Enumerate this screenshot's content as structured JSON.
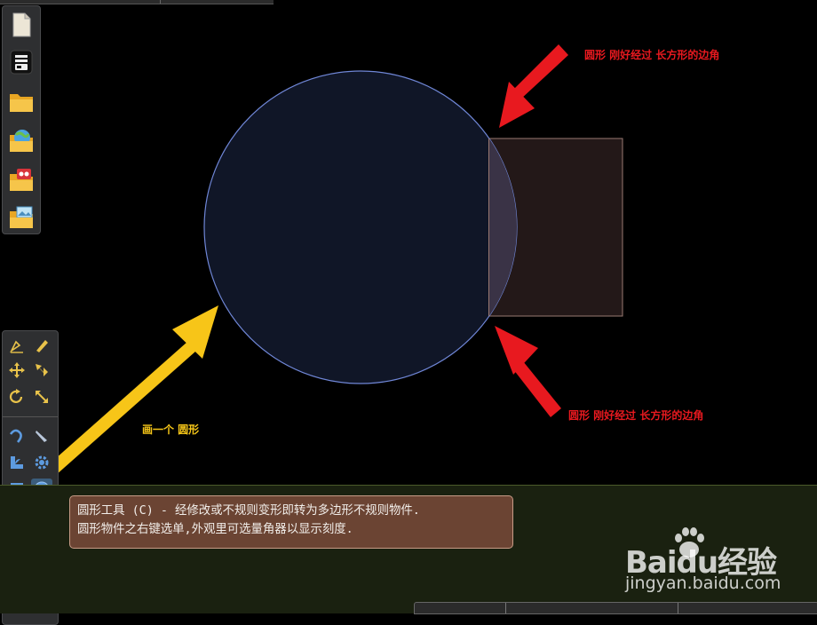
{
  "annotations": {
    "top_right": "圆形 刚好经过 长方形的边角",
    "bottom_right": "圆形 刚好经过 长方形的边角",
    "left": "画一个 圆形"
  },
  "tooltip": {
    "line1": "圆形工具 (C) - 经修改或不规则变形即转为多边形不规则物件.",
    "line2": "圆形物件之右键选单,外观里可选量角器以显示刻度."
  },
  "watermark": {
    "logo": "Baidu经验",
    "url": "jingyan.baidu.com"
  },
  "colors": {
    "circle_fill": "#101627",
    "circle_stroke": "#6f86d6",
    "rect_fill": "#231818",
    "rect_stroke": "#9a7a72",
    "arrow_red": "#e8191f",
    "arrow_yellow": "#f7c518"
  },
  "file_toolbar": {
    "icons": [
      "new-page-icon",
      "toggle-panel-icon",
      "open-folder-icon",
      "folder-web-icon",
      "folder-media-icon",
      "folder-pictures-icon"
    ]
  },
  "tool_toolbar": {
    "icons": [
      "pen-icon",
      "pencil-icon",
      "move-icon",
      "select-arrow-icon",
      "rotate-icon",
      "resize-icon",
      "curve-icon",
      "knife-icon",
      "shape-icon",
      "gear-icon",
      "rectangle-tool-icon",
      "circle-tool-icon",
      "text-tool-icon",
      "eraser-icon",
      "zigzag-icon",
      "close-circle-icon",
      "film-icon",
      "brush-icon",
      "line-icon",
      "undo-icon"
    ]
  }
}
